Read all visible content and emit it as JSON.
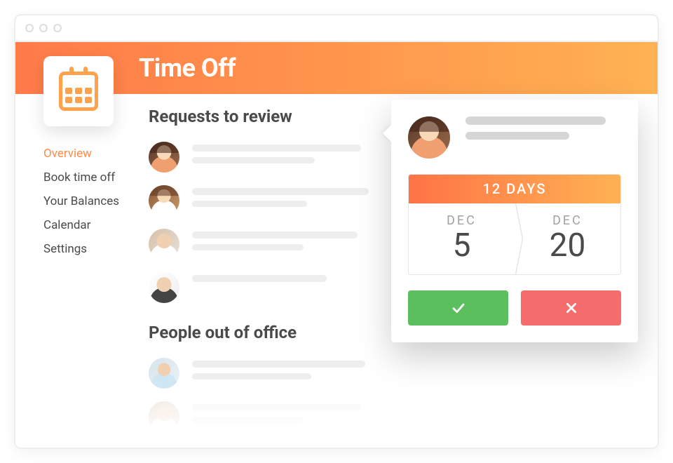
{
  "header": {
    "title": "Time Off"
  },
  "sidebar": {
    "items": [
      {
        "label": "Overview",
        "active": true
      },
      {
        "label": "Book time off"
      },
      {
        "label": "Your Balances"
      },
      {
        "label": "Calendar"
      },
      {
        "label": "Settings"
      }
    ]
  },
  "sections": {
    "requests_title": "Requests to review",
    "out_title": "People out of office"
  },
  "detail": {
    "duration_label": "12 DAYS",
    "start_month": "DEC",
    "start_day": "5",
    "end_month": "DEC",
    "end_day": "20"
  },
  "colors": {
    "accent_start": "#ff7b4a",
    "accent_end": "#ffb253",
    "approve": "#5bbf5d",
    "reject": "#f56c6c"
  }
}
